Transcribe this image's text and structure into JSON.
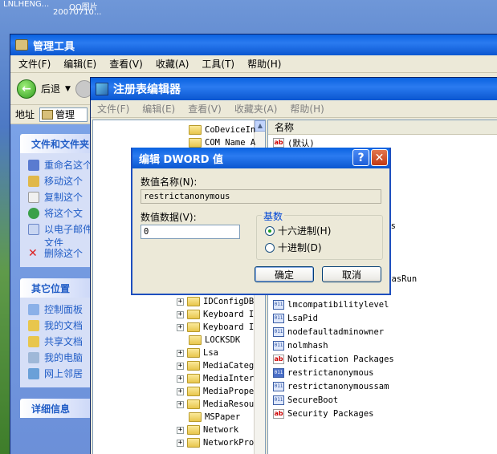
{
  "desktop": {
    "top_text_1": "LNLHENG...",
    "top_text_2": "QQ图片",
    "top_text_3": "20070710..."
  },
  "explorer": {
    "title": "管理工具",
    "menu": [
      "文件(F)",
      "编辑(E)",
      "查看(V)",
      "收藏(A)",
      "工具(T)",
      "帮助(H)"
    ],
    "back_label": "后退",
    "address_label": "地址",
    "address_value": "管理",
    "file_tasks": {
      "header": "文件和文件夹",
      "items": [
        "重命名这个",
        "移动这个",
        "复制这个",
        "将这个文",
        "以电子邮件 文件",
        "删除这个"
      ]
    },
    "other_places": {
      "header": "其它位置",
      "items": [
        "控制面板",
        "我的文档",
        "共享文档",
        "我的电脑",
        "网上邻居"
      ]
    },
    "details": {
      "header": "详细信息"
    }
  },
  "regedit": {
    "title": "注册表编辑器",
    "menu": [
      "文件(F)",
      "编辑(E)",
      "查看(V)",
      "收藏夹(A)",
      "帮助(H)"
    ],
    "tree_items": [
      {
        "label": "CoDeviceIn",
        "expander": ""
      },
      {
        "label": "COM Name A",
        "expander": ""
      },
      {
        "label": "IDConfigDB",
        "expander": "+"
      },
      {
        "label": "Keyboard I",
        "expander": "+"
      },
      {
        "label": "Keyboard I",
        "expander": "+"
      },
      {
        "label": "LOCKSDK",
        "expander": ""
      },
      {
        "label": "Lsa",
        "expander": "+"
      },
      {
        "label": "MediaCateg",
        "expander": "+"
      },
      {
        "label": "MediaInter",
        "expander": "+"
      },
      {
        "label": "MediaPrope",
        "expander": "+"
      },
      {
        "label": "MediaResou",
        "expander": "+"
      },
      {
        "label": "MSPaper",
        "expander": ""
      },
      {
        "label": "Network",
        "expander": "+"
      },
      {
        "label": "NetworkPro",
        "expander": "+"
      }
    ],
    "column_name": "名称",
    "values": [
      {
        "name": "(默认)",
        "type": "sz"
      },
      {
        "name": "es",
        "type": "sz"
      },
      {
        "name": "ous",
        "type": "sz"
      },
      {
        "name": "pgradeToolHasRun",
        "type": "dword"
      },
      {
        "name": "lmcompatibilitylevel",
        "type": "dword"
      },
      {
        "name": "LsaPid",
        "type": "dword"
      },
      {
        "name": "nodefaultadminowner",
        "type": "dword"
      },
      {
        "name": "nolmhash",
        "type": "dword"
      },
      {
        "name": "Notification Packages",
        "type": "sz"
      },
      {
        "name": "restrictanonymous",
        "type": "dword"
      },
      {
        "name": "restrictanonymoussam",
        "type": "dword"
      },
      {
        "name": "SecureBoot",
        "type": "dword"
      },
      {
        "name": "Security Packages",
        "type": "sz"
      }
    ]
  },
  "dialog": {
    "title": "编辑 DWORD 值",
    "value_name_label": "数值名称(N):",
    "value_name": "restrictanonymous",
    "value_data_label": "数值数据(V):",
    "value_data": "0",
    "base_label": "基数",
    "hex_label": "十六进制(H)",
    "dec_label": "十进制(D)",
    "ok_label": "确定",
    "cancel_label": "取消",
    "help_glyph": "?",
    "close_glyph": "✕"
  },
  "colors": {
    "title_bar": "#0a62e0",
    "task_link": "#215dc6",
    "group_title": "#0046d5"
  }
}
